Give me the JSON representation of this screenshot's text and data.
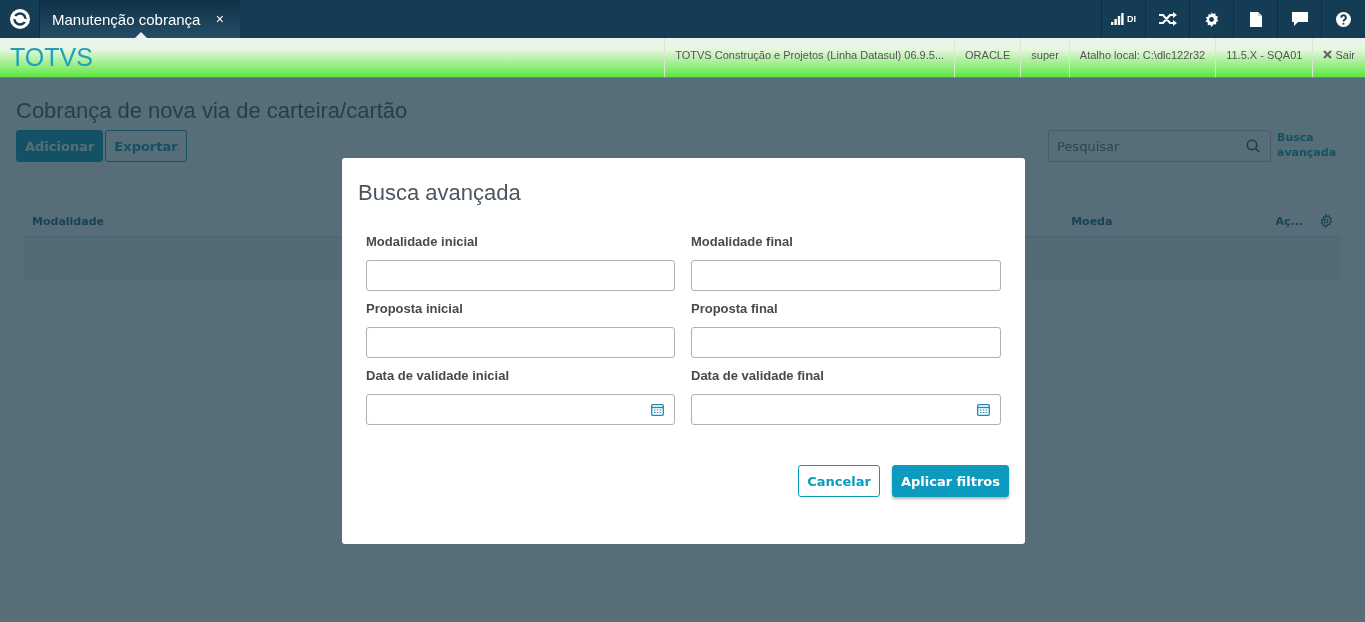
{
  "top_bar": {
    "tab": {
      "label": "Manutenção cobrança",
      "close": "×"
    },
    "signal_label": "DI"
  },
  "header": {
    "brand": "TOTVS",
    "info": [
      "TOTVS Construção e Projetos (Linha Datasul) 06.9.5...",
      "ORACLE",
      "super",
      "Atalho local: C:\\dlc122r32",
      "11.5.X - SQA01"
    ],
    "logout": "Sair"
  },
  "page": {
    "title": "Cobrança de nova via de carteira/cartão",
    "actions": [
      {
        "label": "Adicionar",
        "kind": "primary"
      },
      {
        "label": "Exportar",
        "kind": "secondary"
      }
    ],
    "search": {
      "placeholder": "Pesquisar"
    },
    "advanced_search": "Busca avançada",
    "table": {
      "columns": [
        "Modalidade",
        "Moeda",
        "Aç..."
      ]
    }
  },
  "modal": {
    "title": "Busca avançada",
    "fields": [
      {
        "label": "Modalidade inicial",
        "kind": "text"
      },
      {
        "label": "Modalidade final",
        "kind": "text"
      },
      {
        "label": "Proposta inicial",
        "kind": "text"
      },
      {
        "label": "Proposta final",
        "kind": "text"
      },
      {
        "label": "Data de validade inicial",
        "kind": "date"
      },
      {
        "label": "Data de validade final",
        "kind": "date"
      }
    ],
    "buttons": [
      {
        "label": "Cancelar",
        "kind": "secondary"
      },
      {
        "label": "Aplicar filtros",
        "kind": "primary"
      }
    ]
  }
}
